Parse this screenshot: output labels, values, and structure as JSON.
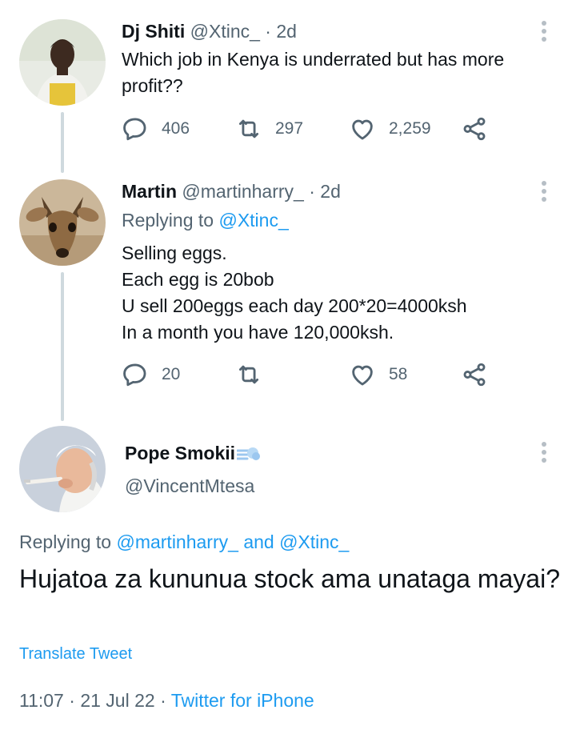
{
  "tweets": [
    {
      "name": "Dj Shiti",
      "handle": "@Xtinc_",
      "time": "2d",
      "text_lines": [
        "Which job in Kenya is underrated but has more",
        "profit??"
      ],
      "replies": "406",
      "retweets": "297",
      "likes": "2,259"
    },
    {
      "name": "Martin",
      "handle": "@martinharry_",
      "time": "2d",
      "replying_label": "Replying to",
      "replying_to": "@Xtinc_",
      "text_lines": [
        "Selling eggs.",
        "Each egg is 20bob",
        "U sell 200eggs each day 200*20=4000ksh",
        "In a month you have 120,000ksh."
      ],
      "replies": "20",
      "retweets": "",
      "likes": "58"
    }
  ],
  "main_tweet": {
    "name": "Pope Smokii",
    "handle": "@VincentMtesa",
    "replying_label": "Replying to",
    "replying_to_1": "@martinharry_",
    "and": "and",
    "replying_to_2": "@Xtinc_",
    "text": "Hujatoa za kununua stock ama unataga mayai?",
    "translate": "Translate Tweet",
    "time": "11:07",
    "date": "21 Jul 22",
    "source": "Twitter for iPhone"
  },
  "colors": {
    "accent": "#1d9bf0",
    "secondary_text": "#536471",
    "thread_line": "#cfd9de"
  },
  "icons": [
    "reply-icon",
    "retweet-icon",
    "like-icon",
    "share-icon",
    "more-icon",
    "dash-emoji-icon"
  ]
}
